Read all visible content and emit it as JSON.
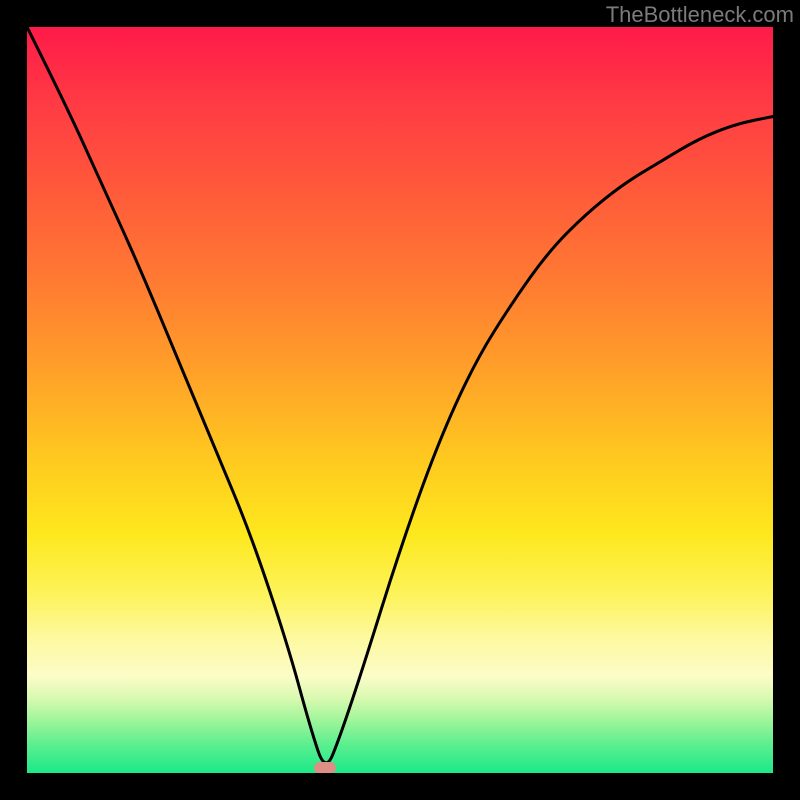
{
  "watermark": "TheBottleneck.com",
  "colors": {
    "frame": "#000000",
    "curve": "#000000",
    "marker": "#dd8f86"
  },
  "chart_data": {
    "type": "line",
    "title": "",
    "xlabel": "",
    "ylabel": "",
    "xlim": [
      0,
      100
    ],
    "ylim": [
      0,
      100
    ],
    "note": "Axes have no tick labels; values are estimated from pixel position as percentage of plot width/height. Minimum (0%) occurs near x≈40; curve rises steeply on both sides forming a V with curved arms, background is a red→green vertical gradient (bottleneck-style chart).",
    "series": [
      {
        "name": "bottleneck-curve",
        "x": [
          0,
          5,
          10,
          15,
          20,
          25,
          30,
          35,
          38,
          40,
          42,
          45,
          50,
          55,
          60,
          65,
          70,
          75,
          80,
          85,
          90,
          95,
          100
        ],
        "values": [
          100,
          90,
          79,
          68,
          56,
          44,
          32,
          17,
          6,
          0,
          5,
          14,
          30,
          44,
          55,
          63,
          70,
          75,
          79,
          82,
          85,
          87,
          88
        ]
      }
    ],
    "marker": {
      "x": 40,
      "y": 0
    },
    "grid": false,
    "legend": false
  }
}
